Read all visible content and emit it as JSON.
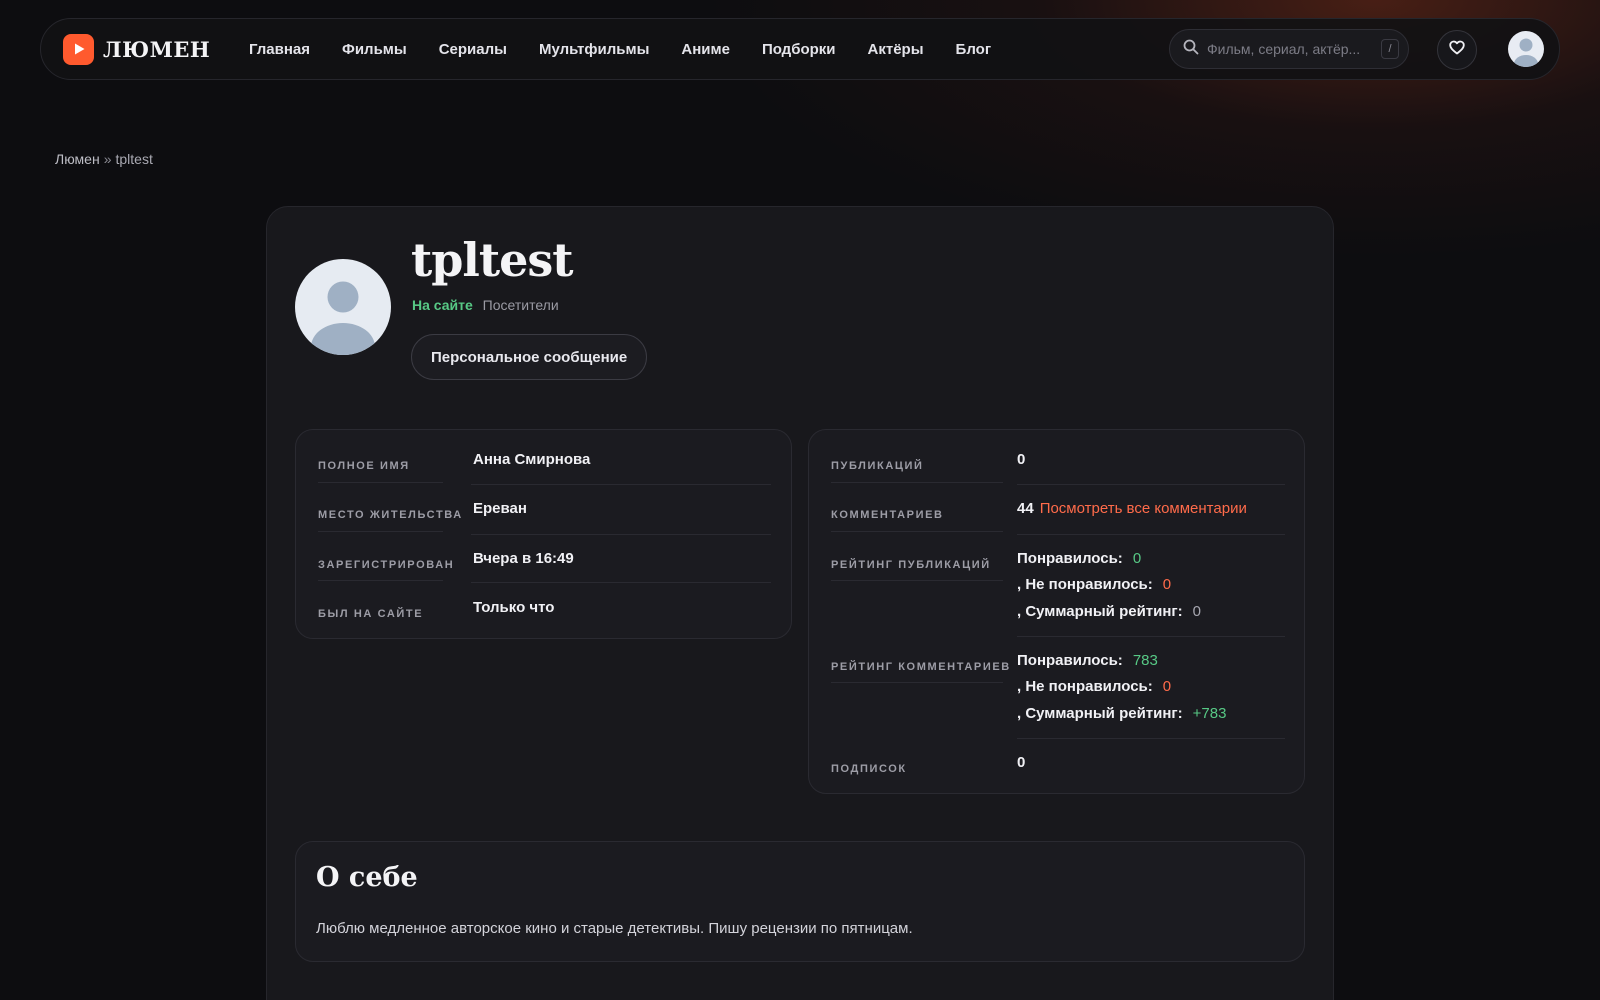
{
  "brand": {
    "name": "ЛЮМЕН",
    "accent": "#ff5a2e"
  },
  "nav": {
    "items": [
      {
        "label": "Главная"
      },
      {
        "label": "Фильмы"
      },
      {
        "label": "Сериалы"
      },
      {
        "label": "Мультфильмы"
      },
      {
        "label": "Аниме"
      },
      {
        "label": "Подборки"
      },
      {
        "label": "Актёры"
      },
      {
        "label": "Блог"
      }
    ]
  },
  "search": {
    "placeholder": "Фильм, сериал, актёр...",
    "shortcut": "/",
    "icon": "search-icon"
  },
  "header_actions": {
    "favorites_icon": "heart-icon",
    "user_icon": "avatar"
  },
  "breadcrumb": {
    "home": "Люмен",
    "separator": "»",
    "current": "tpltest"
  },
  "profile": {
    "username": "tpltest",
    "status": "На сайте",
    "group": "Посетители",
    "pm_button": "Персональное сообщение"
  },
  "details": {
    "full_name_label": "Полное имя",
    "full_name": "Анна Смирнова",
    "location_label": "Место жительства",
    "location": "Ереван",
    "registered_label": "Зарегистрирован",
    "registered": "Вчера в 16:49",
    "last_seen_label": "Был на сайте",
    "last_seen": "Только что"
  },
  "stats": {
    "publications_label": "Публикаций",
    "publications": "0",
    "comments_label": "Комментариев",
    "comments": "44",
    "comments_link": "Посмотреть все комментарии",
    "pub_rating_label": "Рейтинг публикаций",
    "pub_rating": {
      "liked_label": "Понравилось:",
      "liked": "0",
      "disliked_label": ", Не понравилось:",
      "disliked": "0",
      "total_label": ", Суммарный рейтинг:",
      "total": "0"
    },
    "comment_rating_label": "Рейтинг комментариев",
    "comment_rating": {
      "liked_label": "Понравилось:",
      "liked": "783",
      "disliked_label": ", Не понравилось:",
      "disliked": "0",
      "total_label": ", Суммарный рейтинг:",
      "total": "+783"
    },
    "subscriptions_label": "Подписок",
    "subscriptions": "0"
  },
  "about": {
    "title": "О себе",
    "text": "Люблю медленное авторское кино и старые детективы. Пишу рецензии по пятницам."
  },
  "colors": {
    "positive": "#57c985",
    "negative": "#ff6b4a",
    "background": "#0d0d10",
    "card": "#18181c"
  }
}
